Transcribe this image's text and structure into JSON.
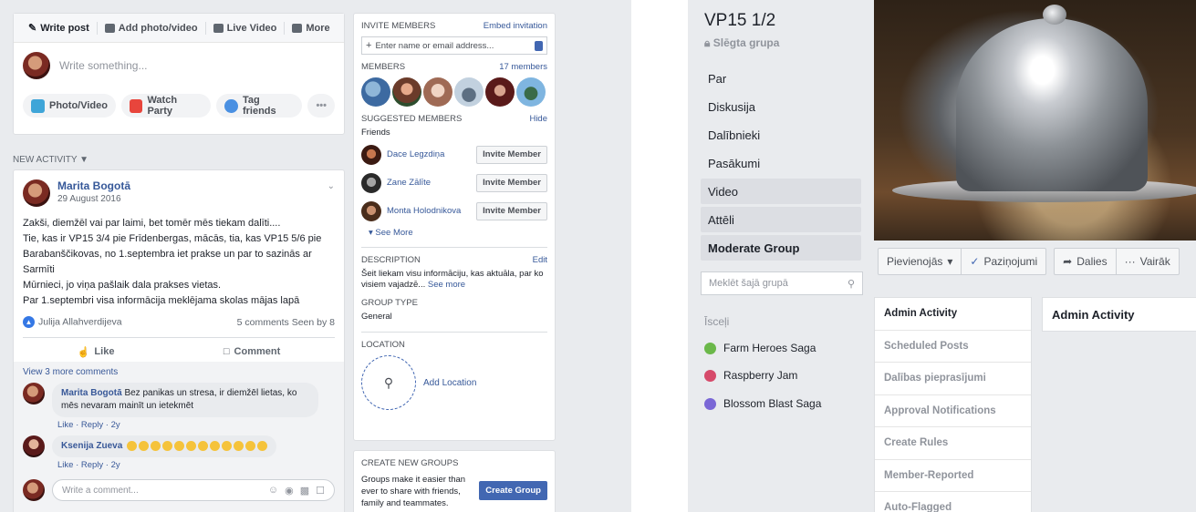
{
  "composer": {
    "tabs": [
      "Write post",
      "Add photo/video",
      "Live Video",
      "More"
    ],
    "placeholder": "Write something...",
    "actions": [
      "Photo/Video",
      "Watch Party",
      "Tag friends",
      "•••"
    ]
  },
  "feed": {
    "section_label": "NEW ACTIVITY",
    "post": {
      "author": "Marita Bogotā",
      "date": "29 August 2016",
      "lines": [
        "Zakši, diemžēl vai par laimi, bet tomēr mēs tiekam dalīti....",
        "Tie, kas ir VP15 3/4 pie Frīdenbergas, mācās, tia, kas VP15 5/6 pie",
        "Barabanščikovas, no 1.septembra iet prakse un par to sazinās ar Sarmīti",
        "Mūrnieci, jo viņa pašlaik dala prakses vietas.",
        "Par 1.septembri visa informācija meklējama skolas mājas lapā"
      ],
      "liker": "Julija Allahverdijeva",
      "stats": "5 comments  Seen by 8",
      "like_label": "Like",
      "comment_label": "Comment",
      "view_more": "View 3 more comments",
      "comments": [
        {
          "author": "Marita Bogotā",
          "text": "Bez panikas un stresa, ir diemžēl lietas, ko mēs nevaram mainīt un ietekmēt",
          "meta": "Like · Reply · 2y"
        },
        {
          "author": "Ksenija Zueva",
          "text": "",
          "meta": "Like · Reply · 2y"
        }
      ],
      "write_comment": "Write a comment..."
    }
  },
  "sidebar": {
    "invite_title": "INVITE MEMBERS",
    "embed_link": "Embed invitation",
    "invite_placeholder": "Enter name or email address...",
    "members_title": "MEMBERS",
    "members_count": "17 members",
    "suggested_title": "SUGGESTED MEMBERS",
    "hide_link": "Hide",
    "friends_label": "Friends",
    "suggested": [
      {
        "name": "Dace Legzdiņa",
        "button": "Invite Member"
      },
      {
        "name": "Zane Zālīte",
        "button": "Invite Member"
      },
      {
        "name": "Monta Holodnikova",
        "button": "Invite Member"
      }
    ],
    "see_more": "See More",
    "description_title": "DESCRIPTION",
    "edit_link": "Edit",
    "description_text": "Šeit liekam visu informāciju, kas aktuāla, par ko visiem vajadzē...",
    "description_more": "See more",
    "group_type_title": "GROUP TYPE",
    "group_type": "General",
    "location_title": "LOCATION",
    "add_location": "Add Location",
    "create_title": "CREATE NEW GROUPS",
    "create_text": "Groups make it easier than ever to share with friends, family and teammates.",
    "create_button": "Create Group"
  },
  "group": {
    "title": "VP15 1/2",
    "privacy": "Slēgta grupa",
    "nav": [
      "Par",
      "Diskusija",
      "Dalībnieki",
      "Pasākumi",
      "Video",
      "Attēli",
      "Moderate Group"
    ],
    "search_placeholder": "Meklēt šajā grupā",
    "shortcuts_title": "Īsceļi",
    "shortcuts": [
      {
        "name": "Farm Heroes Saga",
        "color": "#6bb84a"
      },
      {
        "name": "Raspberry Jam",
        "color": "#d64a6a"
      },
      {
        "name": "Blossom Blast Saga",
        "color": "#7a67d6"
      }
    ],
    "action_join": "Pievienojās",
    "action_notif": "Paziņojumi",
    "action_share": "Dalies",
    "action_more": "Vairāk",
    "admin_items": [
      "Admin Activity",
      "Scheduled Posts",
      "Dalības pieprasījumi",
      "Approval Notifications",
      "Create Rules",
      "Member-Reported",
      "Auto-Flagged"
    ],
    "admin_content_title": "Admin Activity"
  }
}
